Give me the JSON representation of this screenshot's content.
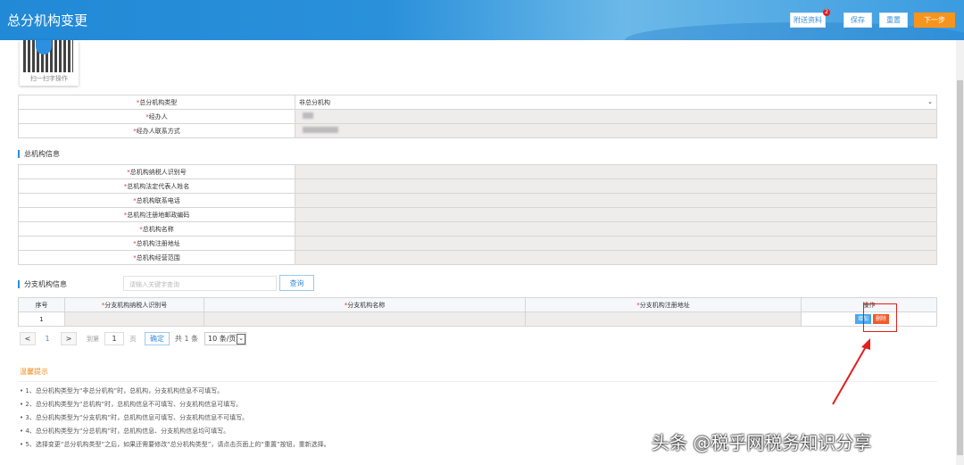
{
  "header": {
    "title": "总分机构变更",
    "buttons": {
      "attach": "附送资料",
      "attach_badge": "2",
      "save": "保存",
      "reset": "重置",
      "next": "下一步"
    }
  },
  "qr": {
    "caption": "扫一扫字操作"
  },
  "basic": {
    "rows": [
      {
        "label": "总分机构类型",
        "value": "非总分机构"
      },
      {
        "label": "经办人",
        "value": ""
      },
      {
        "label": "经办人联系方式",
        "value": ""
      }
    ]
  },
  "head_office": {
    "title": "总机构信息",
    "rows": [
      {
        "label": "总机构纳税人识别号"
      },
      {
        "label": "总机构法定代表人姓名"
      },
      {
        "label": "总机构联系电话"
      },
      {
        "label": "总机构注册地邮政编码"
      },
      {
        "label": "总机构名称"
      },
      {
        "label": "总机构注册地址"
      },
      {
        "label": "总机构经营范围"
      }
    ]
  },
  "branch": {
    "title": "分支机构信息",
    "search_placeholder": "请输入关键字查询",
    "query": "查询",
    "columns": [
      "序号",
      "分支机构纳税人识别号",
      "分支机构名称",
      "分支机构注册地址",
      "操作"
    ],
    "rows": [
      {
        "index": "1",
        "add": "增加",
        "delete": "删除"
      }
    ]
  },
  "pagination": {
    "prev": "<",
    "current": "1",
    "next": ">",
    "goto": "到第",
    "page_input": "1",
    "page_unit": "页",
    "confirm": "确定",
    "total": "共 1 条",
    "page_size": "10 条/页"
  },
  "tips": {
    "title": "温馨提示",
    "items": [
      "1、总分机构类型为“非总分机构”时，总机构，分支机构信息不可填写。",
      "2、总分机构类型为“总机构”时，总机构信息不可填写、分支机构信息可填写。",
      "3、总分机构类型为“分支机构”时，总机构信息可填写、分支机构信息不可填写。",
      "4、总分机构类型为“分总机构”时，总机构信息、分支机构信息均可填写。",
      "5、选择变更“总分机构类型”之后，如果还需要修改“总分机构类型”，请点击页面上的“重置”按钮，重新选择。"
    ]
  },
  "watermark": "头条 @税乎网税务知识分享"
}
